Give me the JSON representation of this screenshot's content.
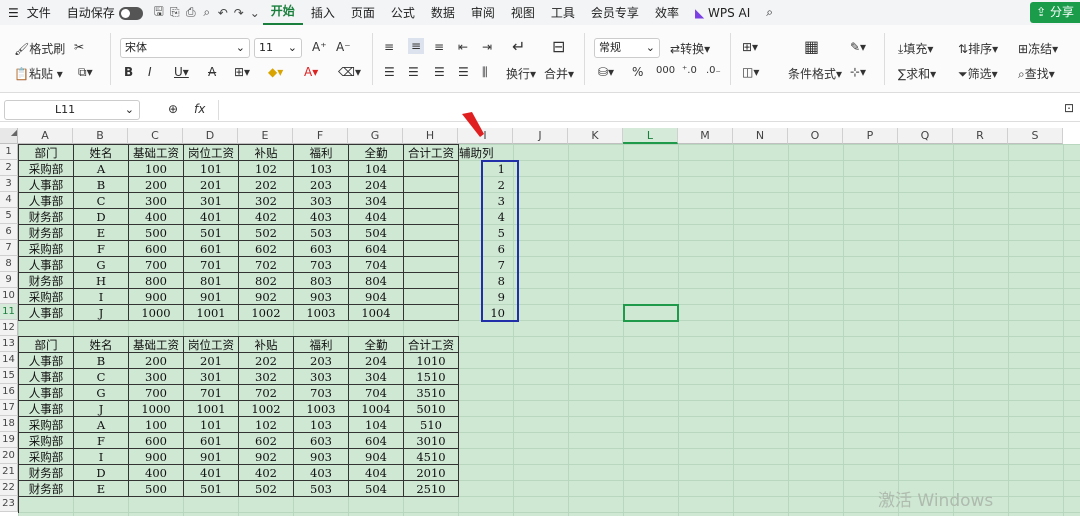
{
  "menubar": {
    "file": "文件",
    "autosave": "自动保存",
    "tabs": [
      "开始",
      "插入",
      "页面",
      "公式",
      "数据",
      "审阅",
      "视图",
      "工具",
      "会员专享",
      "效率"
    ],
    "wps_ai": "WPS AI",
    "share": "分享"
  },
  "ribbon": {
    "format_painter": "格式刷",
    "paste": "粘贴",
    "font_name": "宋体",
    "font_size": "11",
    "number_format": "常规",
    "convert": "转换",
    "wrap": "换行",
    "merge": "合并",
    "conditional_format": "条件格式",
    "fill": "填充",
    "sort": "排序",
    "freeze": "冻结",
    "sum": "求和",
    "filter": "筛选",
    "find": "查找"
  },
  "formula_bar": {
    "name_box": "L11",
    "fx": "fx",
    "value": ""
  },
  "grid": {
    "columns": [
      "A",
      "B",
      "C",
      "D",
      "E",
      "F",
      "G",
      "H",
      "I",
      "J",
      "K",
      "L",
      "M",
      "N",
      "O",
      "P",
      "Q",
      "R",
      "S"
    ],
    "rows": [
      "1",
      "2",
      "3",
      "4",
      "5",
      "6",
      "7",
      "8",
      "9",
      "10",
      "11",
      "12",
      "13",
      "14",
      "15",
      "16",
      "17",
      "18",
      "19",
      "20",
      "21",
      "22",
      "23"
    ],
    "selected_column": "L",
    "selected_row": "11",
    "table1_header": [
      "部门",
      "姓名",
      "基础工资",
      "岗位工资",
      "补贴",
      "福利",
      "全勤",
      "合计工资"
    ],
    "table1_rows": [
      [
        "采购部",
        "A",
        "100",
        "101",
        "102",
        "103",
        "104",
        ""
      ],
      [
        "人事部",
        "B",
        "200",
        "201",
        "202",
        "203",
        "204",
        ""
      ],
      [
        "人事部",
        "C",
        "300",
        "301",
        "302",
        "303",
        "304",
        ""
      ],
      [
        "财务部",
        "D",
        "400",
        "401",
        "402",
        "403",
        "404",
        ""
      ],
      [
        "财务部",
        "E",
        "500",
        "501",
        "502",
        "503",
        "504",
        ""
      ],
      [
        "采购部",
        "F",
        "600",
        "601",
        "602",
        "603",
        "604",
        ""
      ],
      [
        "人事部",
        "G",
        "700",
        "701",
        "702",
        "703",
        "704",
        ""
      ],
      [
        "财务部",
        "H",
        "800",
        "801",
        "802",
        "803",
        "804",
        ""
      ],
      [
        "采购部",
        "I",
        "900",
        "901",
        "902",
        "903",
        "904",
        ""
      ],
      [
        "人事部",
        "J",
        "1000",
        "1001",
        "1002",
        "1003",
        "1004",
        ""
      ]
    ],
    "helper_header": "辅助列",
    "helper_values": [
      "1",
      "2",
      "3",
      "4",
      "5",
      "6",
      "7",
      "8",
      "9",
      "10"
    ],
    "table2_header": [
      "部门",
      "姓名",
      "基础工资",
      "岗位工资",
      "补贴",
      "福利",
      "全勤",
      "合计工资"
    ],
    "table2_rows": [
      [
        "人事部",
        "B",
        "200",
        "201",
        "202",
        "203",
        "204",
        "1010"
      ],
      [
        "人事部",
        "C",
        "300",
        "301",
        "302",
        "303",
        "304",
        "1510"
      ],
      [
        "人事部",
        "G",
        "700",
        "701",
        "702",
        "703",
        "704",
        "3510"
      ],
      [
        "人事部",
        "J",
        "1000",
        "1001",
        "1002",
        "1003",
        "1004",
        "5010"
      ],
      [
        "采购部",
        "A",
        "100",
        "101",
        "102",
        "103",
        "104",
        "510"
      ],
      [
        "采购部",
        "F",
        "600",
        "601",
        "602",
        "603",
        "604",
        "3010"
      ],
      [
        "采购部",
        "I",
        "900",
        "901",
        "902",
        "903",
        "904",
        "4510"
      ],
      [
        "财务部",
        "D",
        "400",
        "401",
        "402",
        "403",
        "404",
        "2010"
      ],
      [
        "财务部",
        "E",
        "500",
        "501",
        "502",
        "503",
        "504",
        "2510"
      ]
    ]
  },
  "watermark": "激活 Windows",
  "colors": {
    "accent": "#1a7f3c",
    "sheet_bg": "#cfe8d3",
    "helper_border": "#2130a8",
    "arrow": "#e02020"
  }
}
